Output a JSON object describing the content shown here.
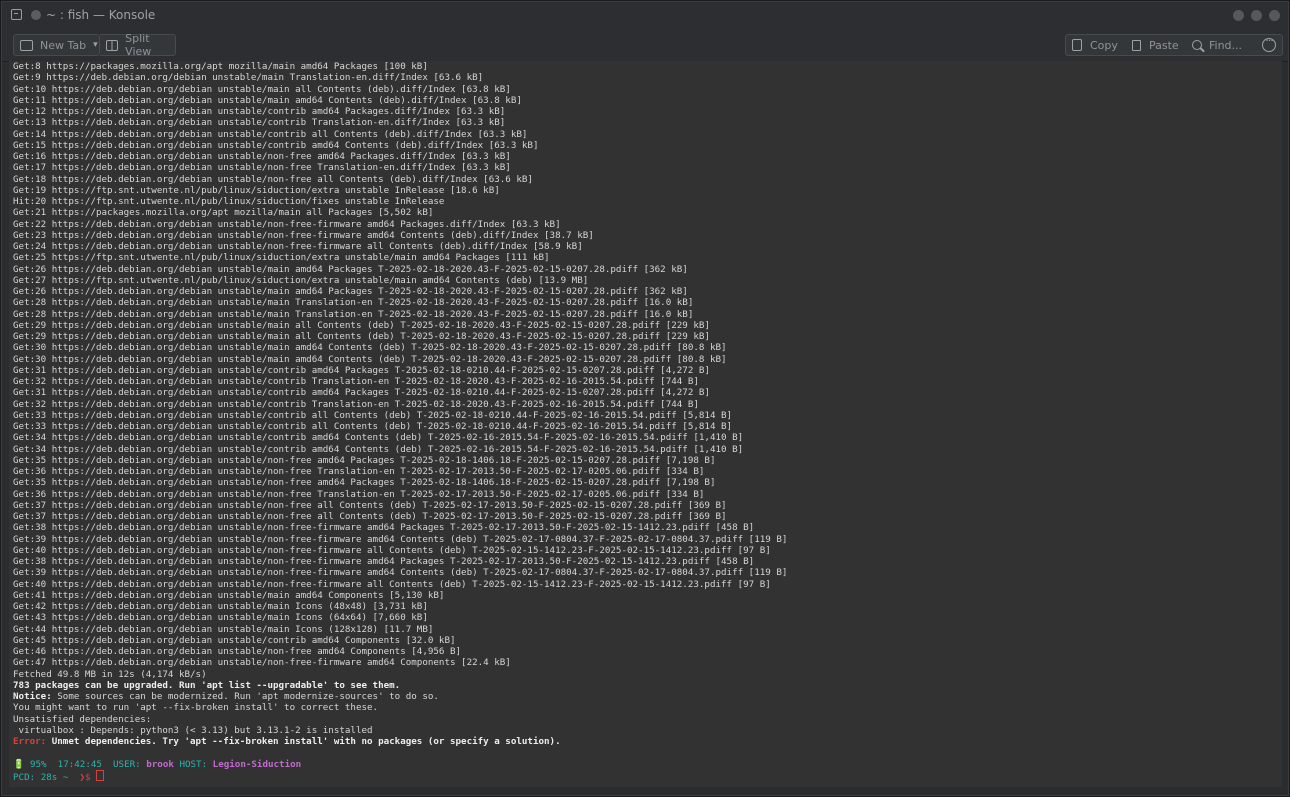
{
  "window": {
    "title": "~ : fish — Konsole"
  },
  "toolbar": {
    "new_tab": "New Tab",
    "split_view": "Split View",
    "copy": "Copy",
    "paste": "Paste",
    "find": "Find..."
  },
  "terminal": {
    "lines": [
      "Get:8 https://packages.mozilla.org/apt mozilla/main amd64 Packages [100 kB]",
      "Get:9 https://deb.debian.org/debian unstable/main Translation-en.diff/Index [63.6 kB]",
      "Get:10 https://deb.debian.org/debian unstable/main all Contents (deb).diff/Index [63.8 kB]",
      "Get:11 https://deb.debian.org/debian unstable/main amd64 Contents (deb).diff/Index [63.8 kB]",
      "Get:12 https://deb.debian.org/debian unstable/contrib amd64 Packages.diff/Index [63.3 kB]",
      "Get:13 https://deb.debian.org/debian unstable/contrib Translation-en.diff/Index [63.3 kB]",
      "Get:14 https://deb.debian.org/debian unstable/contrib all Contents (deb).diff/Index [63.3 kB]",
      "Get:15 https://deb.debian.org/debian unstable/contrib amd64 Contents (deb).diff/Index [63.3 kB]",
      "Get:16 https://deb.debian.org/debian unstable/non-free amd64 Packages.diff/Index [63.3 kB]",
      "Get:17 https://deb.debian.org/debian unstable/non-free Translation-en.diff/Index [63.3 kB]",
      "Get:18 https://deb.debian.org/debian unstable/non-free all Contents (deb).diff/Index [63.6 kB]",
      "Get:19 https://ftp.snt.utwente.nl/pub/linux/siduction/extra unstable InRelease [18.6 kB]",
      "Hit:20 https://ftp.snt.utwente.nl/pub/linux/siduction/fixes unstable InRelease",
      "Get:21 https://packages.mozilla.org/apt mozilla/main all Packages [5,502 kB]",
      "Get:22 https://deb.debian.org/debian unstable/non-free-firmware amd64 Packages.diff/Index [63.3 kB]",
      "Get:23 https://deb.debian.org/debian unstable/non-free-firmware amd64 Contents (deb).diff/Index [38.7 kB]",
      "Get:24 https://deb.debian.org/debian unstable/non-free-firmware all Contents (deb).diff/Index [58.9 kB]",
      "Get:25 https://ftp.snt.utwente.nl/pub/linux/siduction/extra unstable/main amd64 Packages [111 kB]",
      "Get:26 https://deb.debian.org/debian unstable/main amd64 Packages T-2025-02-18-2020.43-F-2025-02-15-0207.28.pdiff [362 kB]",
      "Get:27 https://ftp.snt.utwente.nl/pub/linux/siduction/extra unstable/main amd64 Contents (deb) [13.9 MB]",
      "Get:26 https://deb.debian.org/debian unstable/main amd64 Packages T-2025-02-18-2020.43-F-2025-02-15-0207.28.pdiff [362 kB]",
      "Get:28 https://deb.debian.org/debian unstable/main Translation-en T-2025-02-18-2020.43-F-2025-02-15-0207.28.pdiff [16.0 kB]",
      "Get:28 https://deb.debian.org/debian unstable/main Translation-en T-2025-02-18-2020.43-F-2025-02-15-0207.28.pdiff [16.0 kB]",
      "Get:29 https://deb.debian.org/debian unstable/main all Contents (deb) T-2025-02-18-2020.43-F-2025-02-15-0207.28.pdiff [229 kB]",
      "Get:29 https://deb.debian.org/debian unstable/main all Contents (deb) T-2025-02-18-2020.43-F-2025-02-15-0207.28.pdiff [229 kB]",
      "Get:30 https://deb.debian.org/debian unstable/main amd64 Contents (deb) T-2025-02-18-2020.43-F-2025-02-15-0207.28.pdiff [80.8 kB]",
      "Get:30 https://deb.debian.org/debian unstable/main amd64 Contents (deb) T-2025-02-18-2020.43-F-2025-02-15-0207.28.pdiff [80.8 kB]",
      "Get:31 https://deb.debian.org/debian unstable/contrib amd64 Packages T-2025-02-18-0210.44-F-2025-02-15-0207.28.pdiff [4,272 B]",
      "Get:32 https://deb.debian.org/debian unstable/contrib Translation-en T-2025-02-18-2020.43-F-2025-02-16-2015.54.pdiff [744 B]",
      "Get:31 https://deb.debian.org/debian unstable/contrib amd64 Packages T-2025-02-18-0210.44-F-2025-02-15-0207.28.pdiff [4,272 B]",
      "Get:32 https://deb.debian.org/debian unstable/contrib Translation-en T-2025-02-18-2020.43-F-2025-02-16-2015.54.pdiff [744 B]",
      "Get:33 https://deb.debian.org/debian unstable/contrib all Contents (deb) T-2025-02-18-0210.44-F-2025-02-16-2015.54.pdiff [5,814 B]",
      "Get:33 https://deb.debian.org/debian unstable/contrib all Contents (deb) T-2025-02-18-0210.44-F-2025-02-16-2015.54.pdiff [5,814 B]",
      "Get:34 https://deb.debian.org/debian unstable/contrib amd64 Contents (deb) T-2025-02-16-2015.54-F-2025-02-16-2015.54.pdiff [1,410 B]",
      "Get:34 https://deb.debian.org/debian unstable/contrib amd64 Contents (deb) T-2025-02-16-2015.54-F-2025-02-16-2015.54.pdiff [1,410 B]",
      "Get:35 https://deb.debian.org/debian unstable/non-free amd64 Packages T-2025-02-18-1406.18-F-2025-02-15-0207.28.pdiff [7,198 B]",
      "Get:36 https://deb.debian.org/debian unstable/non-free Translation-en T-2025-02-17-2013.50-F-2025-02-17-0205.06.pdiff [334 B]",
      "Get:35 https://deb.debian.org/debian unstable/non-free amd64 Packages T-2025-02-18-1406.18-F-2025-02-15-0207.28.pdiff [7,198 B]",
      "Get:36 https://deb.debian.org/debian unstable/non-free Translation-en T-2025-02-17-2013.50-F-2025-02-17-0205.06.pdiff [334 B]",
      "Get:37 https://deb.debian.org/debian unstable/non-free all Contents (deb) T-2025-02-17-2013.50-F-2025-02-15-0207.28.pdiff [369 B]",
      "Get:37 https://deb.debian.org/debian unstable/non-free all Contents (deb) T-2025-02-17-2013.50-F-2025-02-15-0207.28.pdiff [369 B]",
      "Get:38 https://deb.debian.org/debian unstable/non-free-firmware amd64 Packages T-2025-02-17-2013.50-F-2025-02-15-1412.23.pdiff [458 B]",
      "Get:39 https://deb.debian.org/debian unstable/non-free-firmware amd64 Contents (deb) T-2025-02-17-0804.37-F-2025-02-17-0804.37.pdiff [119 B]",
      "Get:40 https://deb.debian.org/debian unstable/non-free-firmware all Contents (deb) T-2025-02-15-1412.23-F-2025-02-15-1412.23.pdiff [97 B]",
      "Get:38 https://deb.debian.org/debian unstable/non-free-firmware amd64 Packages T-2025-02-17-2013.50-F-2025-02-15-1412.23.pdiff [458 B]",
      "Get:39 https://deb.debian.org/debian unstable/non-free-firmware amd64 Contents (deb) T-2025-02-17-0804.37-F-2025-02-17-0804.37.pdiff [119 B]",
      "Get:40 https://deb.debian.org/debian unstable/non-free-firmware all Contents (deb) T-2025-02-15-1412.23-F-2025-02-15-1412.23.pdiff [97 B]",
      "Get:41 https://deb.debian.org/debian unstable/main amd64 Components [5,130 kB]",
      "Get:42 https://deb.debian.org/debian unstable/main Icons (48x48) [3,731 kB]",
      "Get:43 https://deb.debian.org/debian unstable/main Icons (64x64) [7,660 kB]",
      "Get:44 https://deb.debian.org/debian unstable/main Icons (128x128) [11.7 MB]",
      "Get:45 https://deb.debian.org/debian unstable/contrib amd64 Components [32.0 kB]",
      "Get:46 https://deb.debian.org/debian unstable/non-free amd64 Components [4,956 B]",
      "Get:47 https://deb.debian.org/debian unstable/non-free-firmware amd64 Components [22.4 kB]",
      "Fetched 49.8 MB in 12s (4,174 kB/s)"
    ],
    "upgradable": "783 packages can be upgraded. Run 'apt list --upgradable' to see them.",
    "notice_label": "Notice:",
    "notice_text": " Some sources can be modernized. Run 'apt modernize-sources' to do so.",
    "fix_hint": "You might want to run 'apt --fix-broken install' to correct these.",
    "unsat_header": "Unsatisfied dependencies:",
    "unsat_detail": " virtualbox : Depends: python3 (< 3.13) but 3.13.1-2 is installed",
    "error_label": "Error:",
    "error_text": " Unmet dependencies. Try 'apt --fix-broken install' with no packages (or specify a solution).",
    "prompt": {
      "battery": "🔋 95%",
      "time": "17:42:45",
      "user_label": "USER:",
      "user": "brook",
      "host_label": "HOST:",
      "host": "Legion-Siduction",
      "pcd_label": "PCD:",
      "pcd_value": "28s",
      "cwd": "~",
      "symbol": "❯$"
    }
  },
  "colors": {
    "terminal_bg": "#323232",
    "text": "#d6d6d6",
    "error": "#d2453a",
    "cyan": "#2bb5ad",
    "purple": "#c06ccd"
  }
}
